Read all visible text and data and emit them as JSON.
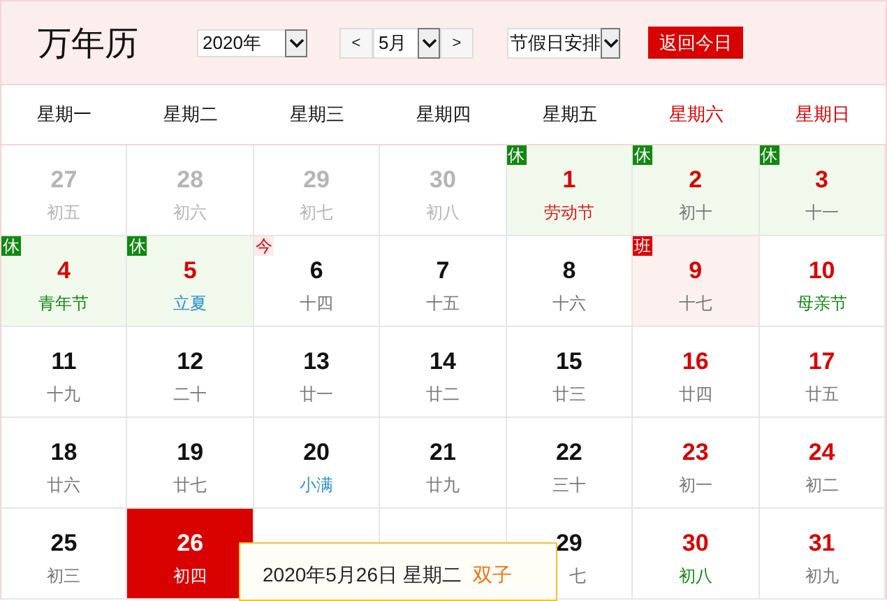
{
  "header": {
    "title": "万年历",
    "year_select": "2020年",
    "prev_button": "<",
    "month_select": "5月",
    "next_button": ">",
    "mode_select": "节假日安排",
    "today_button": "返回今日"
  },
  "weekdays": [
    {
      "label": "星期一",
      "weekend": false
    },
    {
      "label": "星期二",
      "weekend": false
    },
    {
      "label": "星期三",
      "weekend": false
    },
    {
      "label": "星期四",
      "weekend": false
    },
    {
      "label": "星期五",
      "weekend": false
    },
    {
      "label": "星期六",
      "weekend": true
    },
    {
      "label": "星期日",
      "weekend": true
    }
  ],
  "days": [
    {
      "day": "27",
      "lunar": {
        "text": "初五",
        "color": "#b5b5b5"
      },
      "other_month": true,
      "red_date": false,
      "selected": false
    },
    {
      "day": "28",
      "lunar": {
        "text": "初六",
        "color": "#b5b5b5"
      },
      "other_month": true,
      "red_date": false,
      "selected": false
    },
    {
      "day": "29",
      "lunar": {
        "text": "初七",
        "color": "#b5b5b5"
      },
      "other_month": true,
      "red_date": false,
      "selected": false
    },
    {
      "day": "30",
      "lunar": {
        "text": "初八",
        "color": "#b5b5b5"
      },
      "other_month": true,
      "red_date": false,
      "selected": false
    },
    {
      "day": "1",
      "lunar": {
        "text": "劳动节",
        "color": "#d91a1a"
      },
      "other_month": false,
      "red_date": true,
      "badge": {
        "text": "休",
        "kind": "rest"
      },
      "selected": false
    },
    {
      "day": "2",
      "lunar": {
        "text": "初十",
        "color": "#777777"
      },
      "other_month": false,
      "red_date": true,
      "badge": {
        "text": "休",
        "kind": "rest"
      },
      "selected": false
    },
    {
      "day": "3",
      "lunar": {
        "text": "十一",
        "color": "#777777"
      },
      "other_month": false,
      "red_date": true,
      "badge": {
        "text": "休",
        "kind": "rest"
      },
      "selected": false
    },
    {
      "day": "4",
      "lunar": {
        "text": "青年节",
        "color": "#118811"
      },
      "other_month": false,
      "red_date": true,
      "badge": {
        "text": "休",
        "kind": "rest"
      },
      "selected": false
    },
    {
      "day": "5",
      "lunar": {
        "text": "立夏",
        "color": "#2a8fd0"
      },
      "other_month": false,
      "red_date": true,
      "badge": {
        "text": "休",
        "kind": "rest"
      },
      "selected": false
    },
    {
      "day": "6",
      "lunar": {
        "text": "十四",
        "color": "#777777"
      },
      "other_month": false,
      "red_date": false,
      "badge": {
        "text": "今",
        "kind": "today"
      },
      "selected": false
    },
    {
      "day": "7",
      "lunar": {
        "text": "十五",
        "color": "#777777"
      },
      "other_month": false,
      "red_date": false,
      "selected": false
    },
    {
      "day": "8",
      "lunar": {
        "text": "十六",
        "color": "#777777"
      },
      "other_month": false,
      "red_date": false,
      "selected": false
    },
    {
      "day": "9",
      "lunar": {
        "text": "十七",
        "color": "#777777"
      },
      "other_month": false,
      "red_date": true,
      "badge": {
        "text": "班",
        "kind": "work"
      },
      "selected": false
    },
    {
      "day": "10",
      "lunar": {
        "text": "母亲节",
        "color": "#118811"
      },
      "other_month": false,
      "red_date": true,
      "selected": false
    },
    {
      "day": "11",
      "lunar": {
        "text": "十九",
        "color": "#777777"
      },
      "other_month": false,
      "red_date": false,
      "selected": false
    },
    {
      "day": "12",
      "lunar": {
        "text": "二十",
        "color": "#777777"
      },
      "other_month": false,
      "red_date": false,
      "selected": false
    },
    {
      "day": "13",
      "lunar": {
        "text": "廿一",
        "color": "#777777"
      },
      "other_month": false,
      "red_date": false,
      "selected": false
    },
    {
      "day": "14",
      "lunar": {
        "text": "廿二",
        "color": "#777777"
      },
      "other_month": false,
      "red_date": false,
      "selected": false
    },
    {
      "day": "15",
      "lunar": {
        "text": "廿三",
        "color": "#777777"
      },
      "other_month": false,
      "red_date": false,
      "selected": false
    },
    {
      "day": "16",
      "lunar": {
        "text": "廿四",
        "color": "#777777"
      },
      "other_month": false,
      "red_date": true,
      "selected": false
    },
    {
      "day": "17",
      "lunar": {
        "text": "廿五",
        "color": "#777777"
      },
      "other_month": false,
      "red_date": true,
      "selected": false
    },
    {
      "day": "18",
      "lunar": {
        "text": "廿六",
        "color": "#777777"
      },
      "other_month": false,
      "red_date": false,
      "selected": false
    },
    {
      "day": "19",
      "lunar": {
        "text": "廿七",
        "color": "#777777"
      },
      "other_month": false,
      "red_date": false,
      "selected": false
    },
    {
      "day": "20",
      "lunar": {
        "text": "小满",
        "color": "#2a8fd0"
      },
      "other_month": false,
      "red_date": false,
      "selected": false
    },
    {
      "day": "21",
      "lunar": {
        "text": "廿九",
        "color": "#777777"
      },
      "other_month": false,
      "red_date": false,
      "selected": false
    },
    {
      "day": "22",
      "lunar": {
        "text": "三十",
        "color": "#777777"
      },
      "other_month": false,
      "red_date": false,
      "selected": false
    },
    {
      "day": "23",
      "lunar": {
        "text": "初一",
        "color": "#777777"
      },
      "other_month": false,
      "red_date": true,
      "selected": false
    },
    {
      "day": "24",
      "lunar": {
        "text": "初二",
        "color": "#777777"
      },
      "other_month": false,
      "red_date": true,
      "selected": false
    },
    {
      "day": "25",
      "lunar": {
        "text": "初三",
        "color": "#777777"
      },
      "other_month": false,
      "red_date": false,
      "selected": false
    },
    {
      "day": "26",
      "lunar": {
        "text": "初四",
        "color": "#ffffff"
      },
      "other_month": false,
      "red_date": false,
      "selected": true
    },
    {
      "selected": false
    },
    {
      "selected": false
    },
    {
      "day": "29",
      "lunar": {
        "text": "七",
        "color": "#777777"
      },
      "other_month": false,
      "red_date": false,
      "selected": false
    },
    {
      "day": "30",
      "lunar": {
        "text": "初八",
        "color": "#118811"
      },
      "other_month": false,
      "red_date": true,
      "selected": false
    },
    {
      "day": "31",
      "lunar": {
        "text": "初九",
        "color": "#777777"
      },
      "other_month": false,
      "red_date": true,
      "selected": false
    }
  ],
  "tooltip": {
    "date": "2020年5月26日 星期二",
    "zodiac": "双子"
  }
}
